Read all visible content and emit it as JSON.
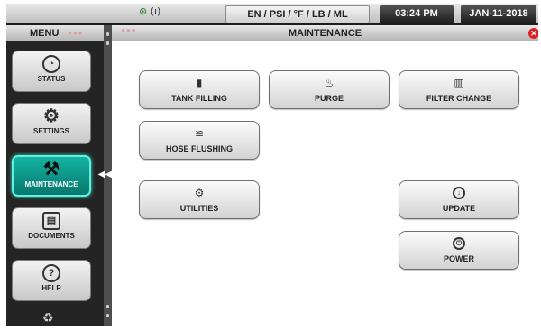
{
  "topbar": {
    "network_icon": "network-icon",
    "signal_text": "(ı)",
    "units": "EN / PSI / °F / LB / ML",
    "time": "03:24 PM",
    "date": "JAN-11-2018"
  },
  "menu": {
    "title": "MENU",
    "items": [
      {
        "label": "STATUS",
        "icon": "gauge-icon"
      },
      {
        "label": "SETTINGS",
        "icon": "gear-icon"
      },
      {
        "label": "MAINTENANCE",
        "icon": "tools-icon"
      },
      {
        "label": "DOCUMENTS",
        "icon": "document-icon"
      },
      {
        "label": "HELP",
        "icon": "help-icon"
      }
    ],
    "bottom_icon": "recycle-icon",
    "active_color": "#0fa596"
  },
  "panel": {
    "title": "MAINTENANCE",
    "buttons": {
      "tank_filling": "TANK FILLING",
      "purge": "PURGE",
      "filter_change": "FILTER CHANGE",
      "hose_flushing": "HOSE FLUSHING",
      "utilities": "UTILITIES",
      "update": "UPDATE",
      "power": "POWER"
    }
  }
}
